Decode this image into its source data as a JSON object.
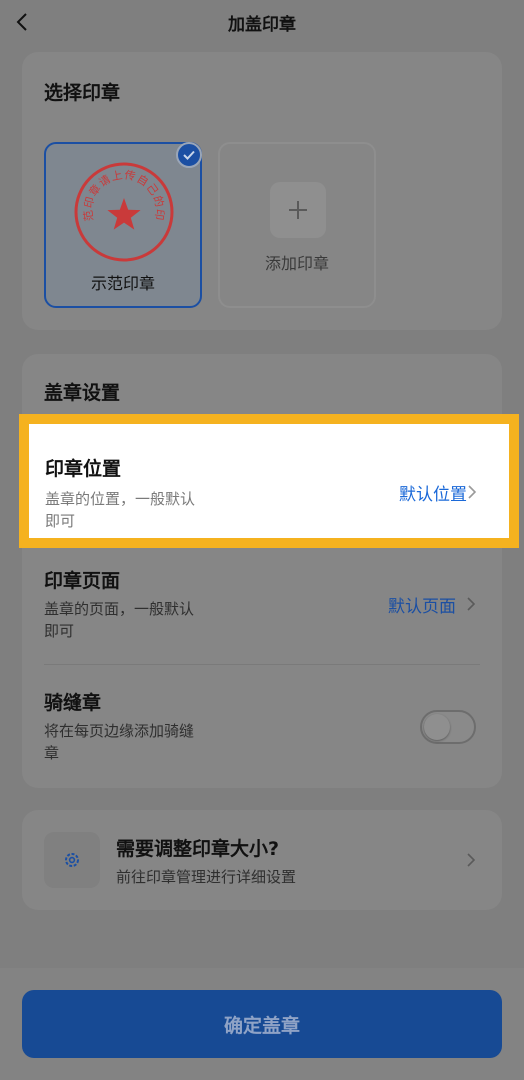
{
  "header": {
    "title": "加盖印章"
  },
  "select_card": {
    "title": "选择印章",
    "stamps": [
      {
        "label": "示范印章",
        "seal_text": "示范印章请上传自己的印章",
        "selected": true
      }
    ],
    "add_label": "添加印章"
  },
  "settings_card": {
    "title": "盖章设置",
    "rows": [
      {
        "title": "印章位置",
        "desc": "盖章的位置，一般默认即可",
        "value": "默认位置"
      },
      {
        "title": "印章页面",
        "desc": "盖章的页面，一般默认即可",
        "value": "默认页面"
      },
      {
        "title": "骑缝章",
        "desc": "将在每页边缘添加骑缝章",
        "toggle_on": false
      }
    ]
  },
  "tip_card": {
    "title": "需要调整印章大小?",
    "desc": "前往印章管理进行详细设置"
  },
  "bottom": {
    "confirm_label": "确定盖章"
  },
  "colors": {
    "accent": "#1b69d8",
    "highlight_border": "#f5b21f",
    "seal_red": "#c93a3a"
  }
}
